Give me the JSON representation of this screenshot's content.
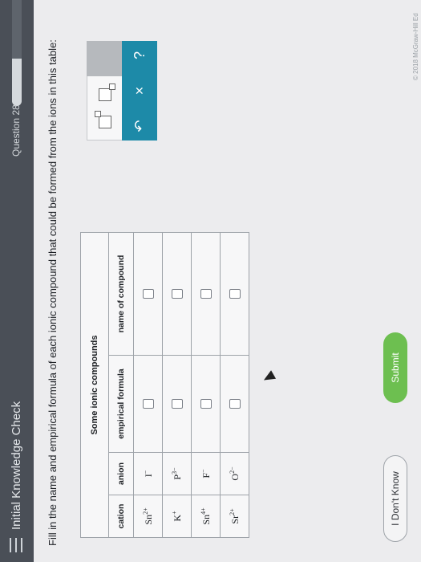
{
  "header": {
    "title": "Initial Knowledge Check",
    "question_label": "Question 28",
    "progress": 0.45
  },
  "instruction": "Fill in the name and empirical formula of each ionic compound that could be formed from the ions in this table:",
  "table": {
    "caption": "Some ionic compounds",
    "columns": [
      "cation",
      "anion",
      "empirical formula",
      "name of compound"
    ],
    "rows": [
      {
        "cation_symbol": "Sn",
        "cation_charge": "2+",
        "anion_symbol": "I",
        "anion_charge": "−"
      },
      {
        "cation_symbol": "K",
        "cation_charge": "+",
        "anion_symbol": "P",
        "anion_charge": "3−"
      },
      {
        "cation_symbol": "Sn",
        "cation_charge": "4+",
        "anion_symbol": "F",
        "anion_charge": "−"
      },
      {
        "cation_symbol": "Sr",
        "cation_charge": "2+",
        "anion_symbol": "O",
        "anion_charge": "2−"
      }
    ]
  },
  "toolbar": {
    "icons": [
      "superscript-box-icon",
      "subscript-box-icon",
      "clear-icon",
      "undo-icon",
      "help-icon"
    ],
    "clear_glyph": "×",
    "undo_glyph": "↶",
    "help_glyph": "?"
  },
  "footer": {
    "dont_know_label": "I Don't Know",
    "submit_label": "Submit",
    "copyright": "© 2018 McGraw-Hill Ed"
  },
  "colors": {
    "header_bg": "#4a4f57",
    "toolbar_accent": "#1d8aa8",
    "submit_green": "#6dbf50"
  }
}
